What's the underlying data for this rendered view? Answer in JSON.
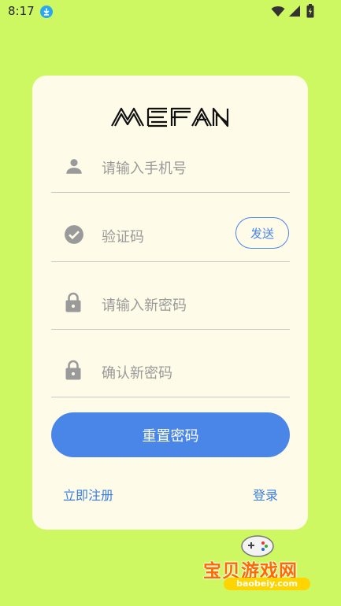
{
  "status_bar": {
    "time": "8:17"
  },
  "card": {
    "logo_text": "MEFAN",
    "phone_field": {
      "placeholder": "请输入手机号",
      "icon": "person-icon"
    },
    "code_field": {
      "placeholder": "验证码",
      "icon": "check-circle-icon",
      "send_label": "发送"
    },
    "new_password_field": {
      "placeholder": "请输入新密码",
      "icon": "lock-icon"
    },
    "confirm_password_field": {
      "placeholder": "确认新密码",
      "icon": "lock-icon"
    },
    "reset_button_label": "重置密码",
    "register_link": "立即注册",
    "login_link": "登录"
  },
  "watermark": {
    "title": "宝贝游戏网",
    "url": "baobeiy.com"
  },
  "colors": {
    "background": "#cdf862",
    "card": "#fefbe8",
    "accent": "#4a86e8",
    "icon_gray": "#9a9a9a"
  }
}
